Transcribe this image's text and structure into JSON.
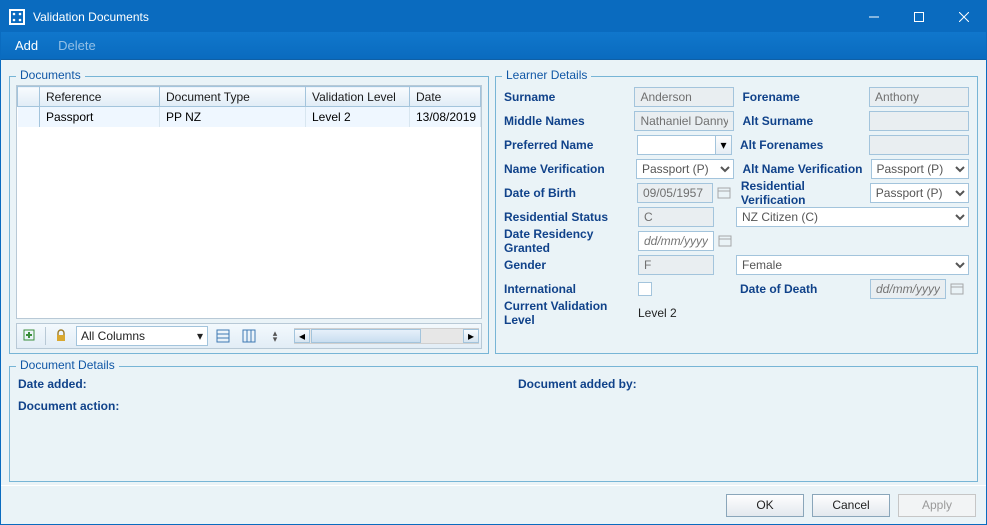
{
  "window": {
    "title": "Validation Documents"
  },
  "menu": {
    "add": "Add",
    "delete": "Delete"
  },
  "documents": {
    "legend": "Documents",
    "cols": {
      "c0": "*",
      "c1": "Reference",
      "c2": "Document Type",
      "c3": "Validation Level",
      "c4": "Date"
    },
    "rows": [
      {
        "ref": "Passport",
        "type": "PP NZ",
        "level": "Level 2",
        "date": "13/08/2019"
      }
    ],
    "toolbar": {
      "allcols": "All Columns"
    }
  },
  "learner": {
    "legend": "Learner Details",
    "labels": {
      "surname": "Surname",
      "forename": "Forename",
      "middle": "Middle Names",
      "altSurname": "Alt Surname",
      "pref": "Preferred Name",
      "altFore": "Alt Forenames",
      "nameVer": "Name Verification",
      "altNameVer": "Alt Name Verification",
      "dob": "Date of Birth",
      "resVer": "Residential Verification",
      "resStat": "Residential Status",
      "resGrant": "Date Residency Granted",
      "gender": "Gender",
      "intl": "International",
      "dod": "Date of Death",
      "curVal": "Current Validation Level"
    },
    "values": {
      "surname": "Anderson",
      "forename": "Anthony",
      "middle": "Nathaniel Danny",
      "altSurname": "",
      "pref": "",
      "altFore": "",
      "nameVer": "Passport (P)",
      "altNameVer": "Passport (P)",
      "dob": "09/05/1957",
      "resVer": "Passport (P)",
      "resStatCode": "C",
      "resStatDesc": "NZ Citizen (C)",
      "resGrant": "",
      "resGrantPlaceholder": "dd/mm/yyyy",
      "genderCode": "F",
      "genderDesc": "Female",
      "dod": "",
      "dodPlaceholder": "dd/mm/yyyy",
      "curVal": "Level 2"
    }
  },
  "docDetails": {
    "legend": "Document Details",
    "dateAddedLbl": "Date added:",
    "addedByLbl": "Document added by:",
    "actionLbl": "Document action:"
  },
  "footer": {
    "ok": "OK",
    "cancel": "Cancel",
    "apply": "Apply"
  }
}
